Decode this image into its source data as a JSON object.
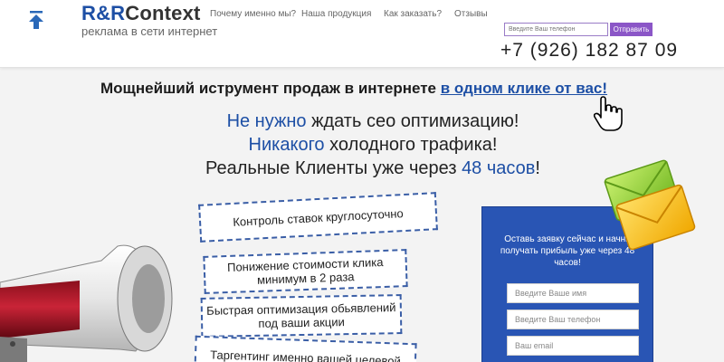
{
  "header": {
    "logo_main": "R&R",
    "logo_context": "Context",
    "logo_sub": "реклама в сети интернет",
    "nav": [
      "Почему именно мы?",
      "Наша продукция",
      "Как заказать?",
      "Отзывы"
    ],
    "phone_placeholder": "Введите Ваш телефон",
    "submit_label": "Отправить",
    "phone_number": "+7 (926) 182 87 09"
  },
  "hero": {
    "headline_text": "Мощнейший иструмент продаж в интернете ",
    "headline_link": "в одном клике от вас!",
    "line1_blue": "Не нужно",
    "line1_rest": " ждать сео оптимизацию!",
    "line2_blue": "Никакого",
    "line2_rest": " холодного трафика!",
    "line3_start": "Реальные Клиенты уже через ",
    "line3_blue": "48 часов",
    "line3_end": "!"
  },
  "features": [
    "Контроль ставок круглосуточно",
    "Понижение стоимости клика минимум в 2 раза",
    "Быстрая оптимизация обьявлений под ваши акции",
    "Таргентинг именно вашей целевой"
  ],
  "form": {
    "title": "Оставь заявку сейчас и начни получать прибыль уже через 48 часов!",
    "name_placeholder": "Введите Ваше имя",
    "phone_placeholder": "Введите Ваш телефон",
    "email_placeholder": "Ваш email"
  },
  "colors": {
    "brand_blue": "#1d4fa5",
    "form_blue": "#2955b4",
    "submit_purple": "#8b56c7"
  }
}
